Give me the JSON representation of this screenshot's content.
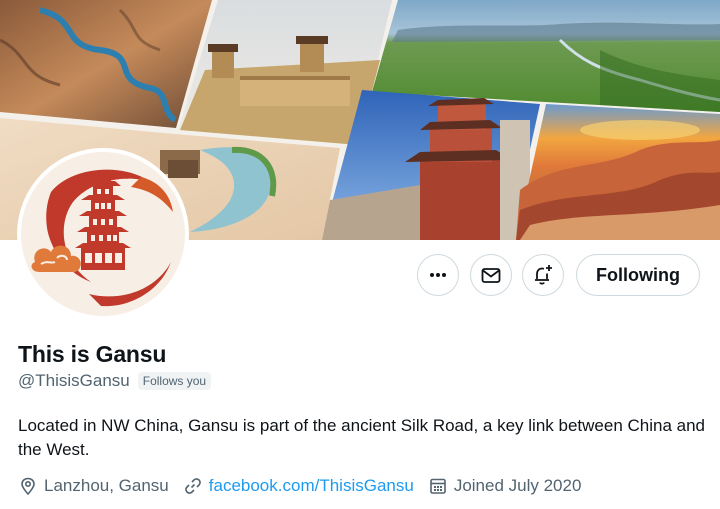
{
  "profile": {
    "name": "This is Gansu",
    "handle": "@ThisisGansu",
    "follows_you": "Follows you",
    "bio": "Located in NW China, Gansu is part of the ancient Silk Road, a key link between China and the West.",
    "location": "Lanzhou, Gansu",
    "website": "facebook.com/ThisisGansu",
    "joined": "Joined July 2020"
  },
  "actions": {
    "following_label": "Following",
    "more_icon": "more-icon",
    "message_icon": "envelope-icon",
    "notify_icon": "bell-plus-icon"
  },
  "colors": {
    "link": "#1d9bf0",
    "secondary_text": "#536471",
    "border": "#cfd9de",
    "logo_red": "#c0392b"
  }
}
